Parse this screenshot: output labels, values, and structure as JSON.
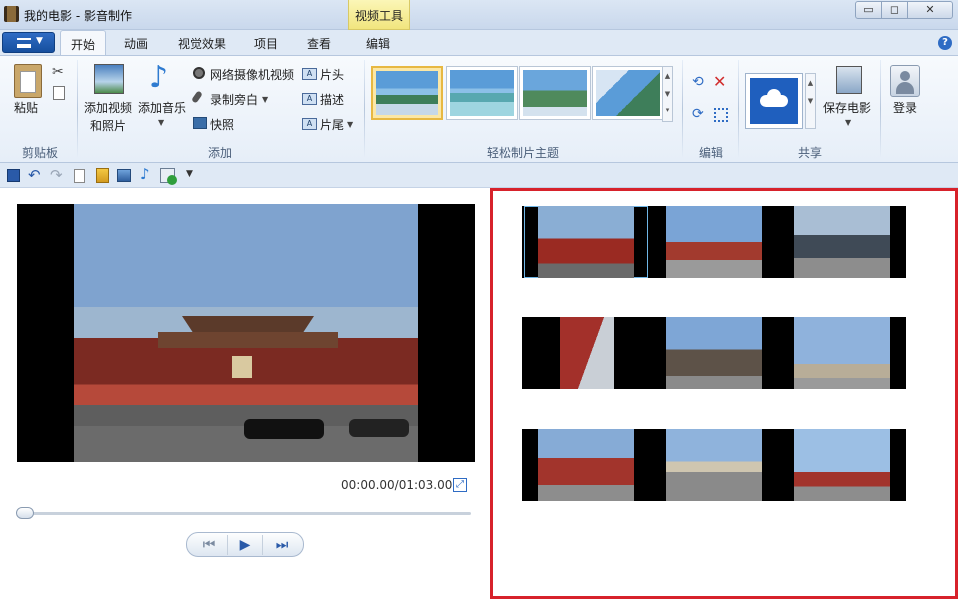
{
  "window": {
    "title": "我的电影 - 影音制作",
    "context_tab": "视频工具",
    "min_glyph": "▭",
    "max_glyph": "◻",
    "close_glyph": "✕"
  },
  "tabs": [
    {
      "label": "开始",
      "active": true
    },
    {
      "label": "动画"
    },
    {
      "label": "视觉效果"
    },
    {
      "label": "项目"
    },
    {
      "label": "查看"
    },
    {
      "label": "编辑"
    }
  ],
  "help_glyph": "?",
  "ribbon": {
    "clipboard": {
      "paste": "粘贴",
      "group": "剪贴板"
    },
    "add": {
      "add_video_line1": "添加视频",
      "add_video_line2": "和照片",
      "add_music": "添加音乐",
      "webcam": "网络摄像机视频",
      "narration": "录制旁白",
      "snapshot": "快照",
      "title": "片头",
      "caption": "描述",
      "credits": "片尾",
      "group": "添加"
    },
    "themes": {
      "group": "轻松制片主题"
    },
    "edit": {
      "group": "编辑"
    },
    "share": {
      "save_movie": "保存电影",
      "group": "共享"
    },
    "signin": {
      "label": "登录"
    }
  },
  "preview": {
    "timecode": "00:00.00/01:03.00",
    "progress": 0
  },
  "storyboard": {
    "rows": 3,
    "clips_per_row": 3
  },
  "colors": {
    "accent": "#2f6cc4",
    "highlight_border": "#d7222b",
    "context_tab": "#f1e57e"
  }
}
